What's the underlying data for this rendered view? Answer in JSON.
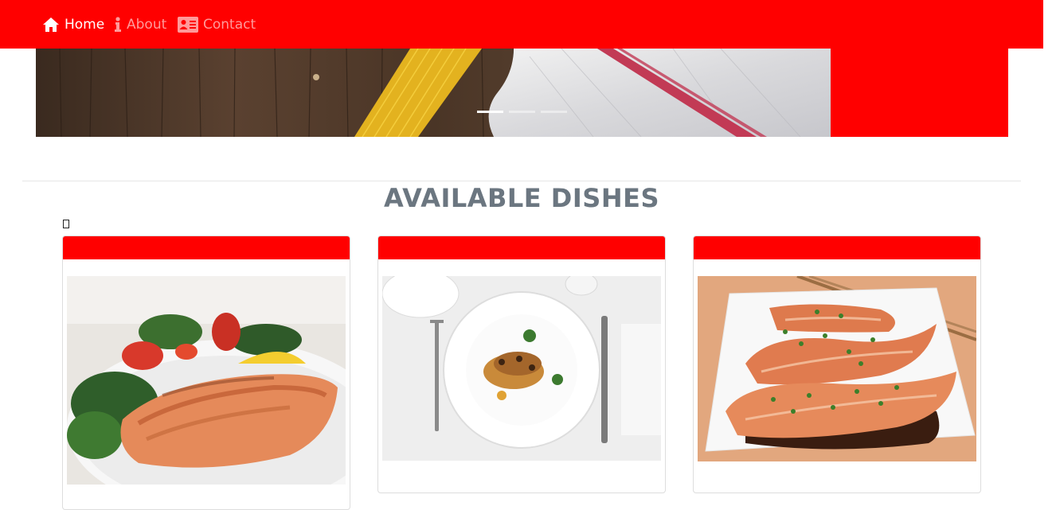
{
  "nav": {
    "items": [
      {
        "label": "Home",
        "icon": "home-icon",
        "active": true
      },
      {
        "label": "About",
        "icon": "info-icon",
        "active": false
      },
      {
        "label": "Contact",
        "icon": "contact-card-icon",
        "active": false
      }
    ]
  },
  "carousel": {
    "image": "pasta-on-wooden-table-with-towel",
    "slide_count": 3,
    "active_slide": 1
  },
  "section": {
    "title": "AVAILABLE DISHES"
  },
  "dishes": [
    {
      "image": "grilled-salmon-salad-plate"
    },
    {
      "image": "plated-fish-dish-with-cutlery"
    },
    {
      "image": "salmon-steaks-with-scallions"
    }
  ],
  "colors": {
    "brand_red": "#ff0000",
    "nav_inactive": "#ff9a9a",
    "heading": "#6b7680"
  }
}
